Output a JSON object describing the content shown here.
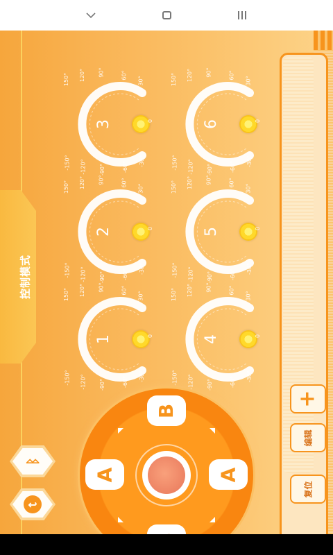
{
  "nav": {
    "back_icon": "chevron-down-icon",
    "home_icon": "square-icon",
    "recent_icon": "bars-icon"
  },
  "mode": {
    "label": "控制模式"
  },
  "side": {
    "add_label": "+",
    "edit_label": "编辑",
    "reset_label": "复位"
  },
  "dials": [
    {
      "num": "1",
      "ticks": [
        "150°",
        "120°",
        "90°",
        "60°",
        "30°",
        "0",
        "-30°",
        "-60°",
        "-90°",
        "-120°",
        "-150°"
      ]
    },
    {
      "num": "2",
      "ticks": [
        "150°",
        "120°",
        "90°",
        "60°",
        "30°",
        "0",
        "-30°",
        "-60°",
        "-90°",
        "-120°",
        "-150°"
      ]
    },
    {
      "num": "3",
      "ticks": [
        "150°",
        "120°",
        "90°",
        "60°",
        "30°",
        "0",
        "-30°",
        "-60°",
        "-90°",
        "-120°",
        "-150°"
      ]
    },
    {
      "num": "4",
      "ticks": [
        "150°",
        "120°",
        "90°",
        "60°",
        "30°",
        "0",
        "-30°",
        "-60°",
        "-90°",
        "-120°",
        "-150°"
      ]
    },
    {
      "num": "5",
      "ticks": [
        "150°",
        "120°",
        "90°",
        "60°",
        "30°",
        "0",
        "-30°",
        "-60°",
        "-90°",
        "-120°",
        "-150°"
      ]
    },
    {
      "num": "6",
      "ticks": [
        "150°",
        "120°",
        "90°",
        "60°",
        "30°",
        "0",
        "-30°",
        "-60°",
        "-90°",
        "-120°",
        "-150°"
      ]
    }
  ],
  "joystick": {
    "left_key": "A",
    "right_key": "A",
    "top_key": "B",
    "bottom_key": "B"
  },
  "colors": {
    "accent": "#f7941d",
    "knob": "#ffd92a"
  }
}
